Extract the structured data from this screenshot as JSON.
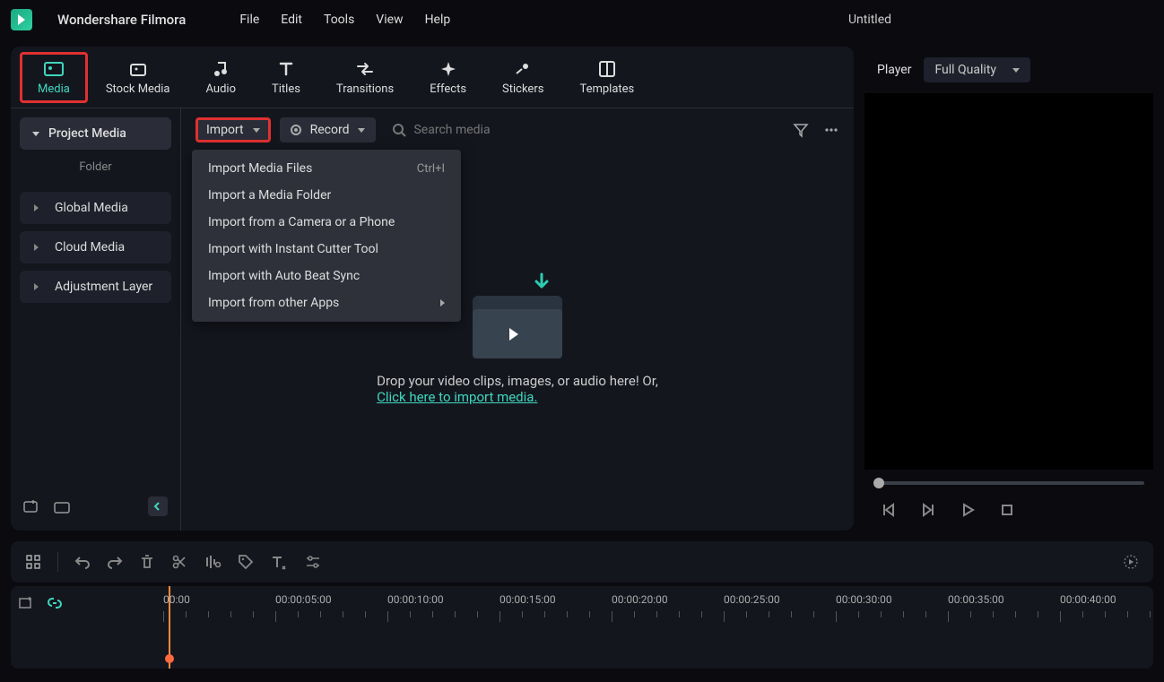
{
  "app": {
    "name": "Wondershare Filmora",
    "doc_title": "Untitled"
  },
  "menu": [
    "File",
    "Edit",
    "Tools",
    "View",
    "Help"
  ],
  "tabs": [
    {
      "label": "Media",
      "icon": "image"
    },
    {
      "label": "Stock Media",
      "icon": "image-stack"
    },
    {
      "label": "Audio",
      "icon": "music-note"
    },
    {
      "label": "Titles",
      "icon": "text-t"
    },
    {
      "label": "Transitions",
      "icon": "swap"
    },
    {
      "label": "Effects",
      "icon": "sparkle"
    },
    {
      "label": "Stickers",
      "icon": "shooting-star"
    },
    {
      "label": "Templates",
      "icon": "layout"
    }
  ],
  "sidebar": {
    "primary": "Project Media",
    "folder_label": "Folder",
    "items": [
      "Global Media",
      "Cloud Media",
      "Adjustment Layer"
    ]
  },
  "toolbar": {
    "import_label": "Import",
    "record_label": "Record",
    "search_placeholder": "Search media"
  },
  "import_menu": [
    {
      "label": "Import Media Files",
      "shortcut": "Ctrl+I"
    },
    {
      "label": "Import a Media Folder"
    },
    {
      "label": "Import from a Camera or a Phone"
    },
    {
      "label": "Import with Instant Cutter Tool"
    },
    {
      "label": "Import with Auto Beat Sync"
    },
    {
      "label": "Import from other Apps",
      "submenu": true
    }
  ],
  "dropzone": {
    "line1": "Drop your video clips, images, or audio here! Or,",
    "link": "Click here to import media."
  },
  "player": {
    "label": "Player",
    "quality": "Full Quality"
  },
  "timeline": {
    "marks": [
      "00:00",
      "00:00:05:00",
      "00:00:10:00",
      "00:00:15:00",
      "00:00:20:00",
      "00:00:25:00",
      "00:00:30:00",
      "00:00:35:00",
      "00:00:40:00"
    ]
  }
}
